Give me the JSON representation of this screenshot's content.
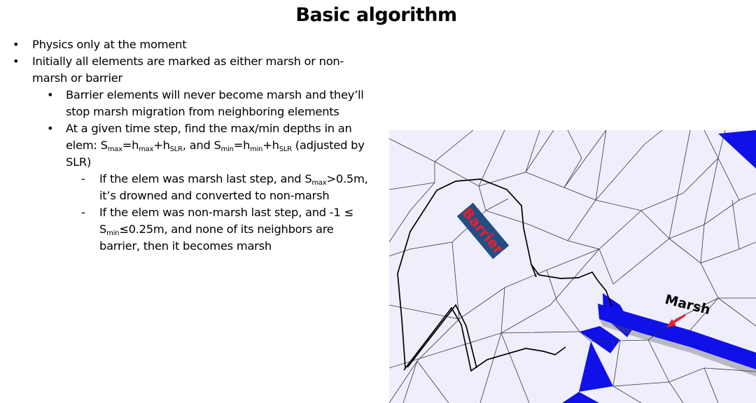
{
  "slide": {
    "title": "Basic algorithm",
    "bullets": [
      {
        "level": 1,
        "marker": "•",
        "text": "Physics only at the moment"
      },
      {
        "level": 1,
        "marker": "•",
        "text": "Initially all elements are marked as either marsh or non-marsh or barrier"
      },
      {
        "level": 2,
        "marker": "•",
        "text": "Barrier elements will never become marsh and they’ll stop marsh migration from neighboring elements"
      },
      {
        "level": 2,
        "marker": "•",
        "parts": [
          "At a given time step, find the max/min  depths in an elem: S",
          "max",
          "=h",
          "max",
          "+h",
          "SLR",
          ", and S",
          "min",
          "=h",
          "min",
          "+h",
          "SLR",
          " (adjusted by SLR)"
        ]
      },
      {
        "level": 3,
        "marker": "-",
        "parts": [
          "If the elem was marsh last step, and S",
          "max",
          ">0.5m, it’s drowned and converted to non-marsh"
        ]
      },
      {
        "level": 3,
        "marker": "-",
        "parts": [
          "If the elem was non-marsh last step, and -1 ≤ S",
          "min",
          "≤0.25m, and none of its neighbors are barrier, then it becomes marsh"
        ]
      }
    ]
  },
  "figure": {
    "barrier_label": "Barrier",
    "marsh_label": "Marsh",
    "colors": {
      "background": "#efeffb",
      "marsh_fill": "#1010e8",
      "barrier_box": "#234e84",
      "barrier_text": "#e8202a",
      "arrow": "#e8202a",
      "mesh_line": "#333344"
    }
  }
}
